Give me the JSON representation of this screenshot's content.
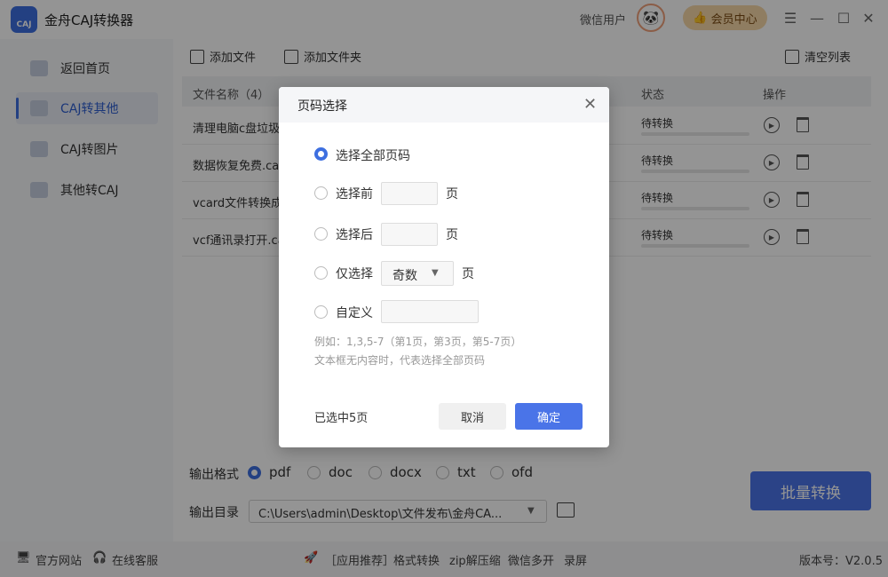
{
  "app": {
    "title": "金舟CAJ转换器",
    "logo_text": "CAJ",
    "wechat_user": "微信用户",
    "vip_label": "会员中心"
  },
  "sidebar": {
    "items": [
      {
        "label": "返回首页",
        "icon": "home-icon",
        "active": false
      },
      {
        "label": "CAJ转其他",
        "icon": "document-icon",
        "active": true
      },
      {
        "label": "CAJ转图片",
        "icon": "image-icon",
        "active": false
      },
      {
        "label": "其他转CAJ",
        "icon": "caj-icon",
        "active": false
      }
    ]
  },
  "toolbar": {
    "add_file": "添加文件",
    "add_folder": "添加文件夹",
    "clear_list": "清空列表"
  },
  "table": {
    "headers": {
      "name": "文件名称（4）",
      "status": "状态",
      "action": "操作"
    },
    "rows": [
      {
        "name": "清理电脑c盘垃圾怎",
        "status": "待转换"
      },
      {
        "name": "数据恢复免费.caj",
        "status": "待转换"
      },
      {
        "name": "vcard文件转换成e",
        "status": "待转换"
      },
      {
        "name": "vcf通讯录打开.caj",
        "status": "待转换"
      }
    ]
  },
  "output": {
    "format_label": "输出格式",
    "formats": [
      "pdf",
      "doc",
      "docx",
      "txt",
      "ofd"
    ],
    "selected_format": "pdf",
    "dir_label": "输出目录",
    "dir_value": "C:\\Users\\admin\\Desktop\\文件发布\\金舟CA..."
  },
  "batch_button": "批量转换",
  "statusbar": {
    "website": "官方网站",
    "support": "在线客服",
    "recommend": "［应用推荐］",
    "links": [
      "格式转换",
      "zip解压缩",
      "微信多开",
      "录屏"
    ],
    "version": "版本号：V2.0.5"
  },
  "dialog": {
    "title": "页码选择",
    "options": {
      "all": "选择全部页码",
      "first": "选择前",
      "last": "选择后",
      "only": "仅选择",
      "custom": "自定义"
    },
    "unit": "页",
    "parity_value": "奇数",
    "hint1": "例如：1,3,5-7（第1页，第3页，第5-7页）",
    "hint2": "文本框无内容时，代表选择全部页码",
    "selected_count": "已选中5页",
    "cancel": "取消",
    "ok": "确定"
  },
  "colors": {
    "accent": "#4a74e8",
    "vip_bg": "#f6d8a8",
    "overlay": "rgba(0,0,0,0.42)"
  }
}
